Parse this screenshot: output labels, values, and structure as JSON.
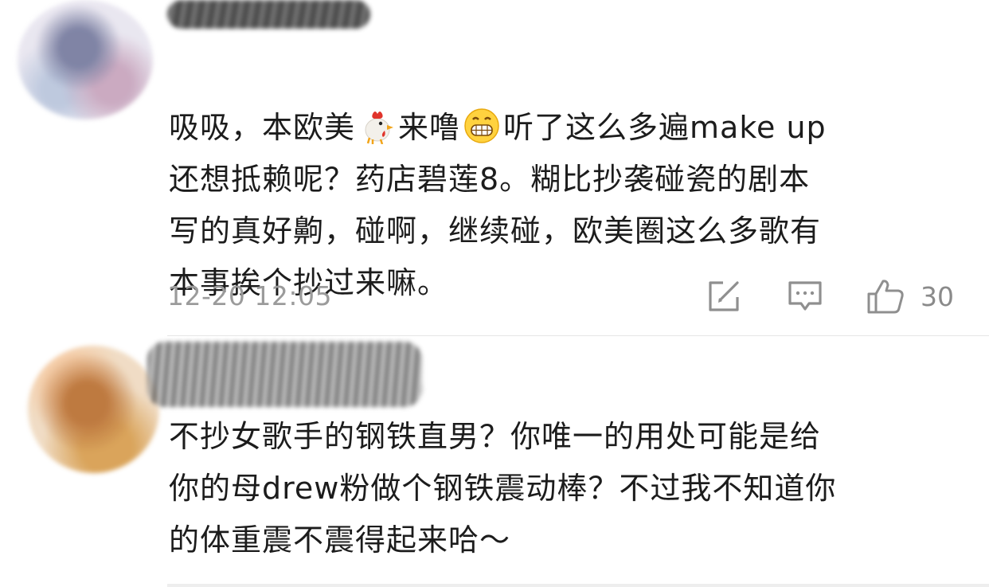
{
  "comments": [
    {
      "text_lines": [
        "吸吸，本欧美",
        "来噜",
        "听了这么多遍make up",
        "还想抵赖呢？药店碧莲8。糊比抄袭碰瓷的剧本",
        "写的真好齁，碰啊，继续碰，欧美圈这么多歌有",
        "本事挨个抄过来嘛。"
      ],
      "emoji_1": "chicken-emoji",
      "emoji_2": "grinning-face-emoji",
      "timestamp": "12-20 12:05",
      "like_count": "30"
    },
    {
      "text_lines": [
        "不抄女歌手的钢铁直男？你唯一的用处可能是给",
        "你的母drew粉做个钢铁震动棒？不过我不知道你",
        "的体重震不震得起来哈～"
      ]
    }
  ],
  "icons": {
    "repost": "repost-icon",
    "reply": "reply-icon",
    "like": "thumbs-up-icon"
  },
  "colors": {
    "text": "#1c1c1c",
    "meta": "#9b9b9b",
    "divider": "#e6e6e6"
  }
}
